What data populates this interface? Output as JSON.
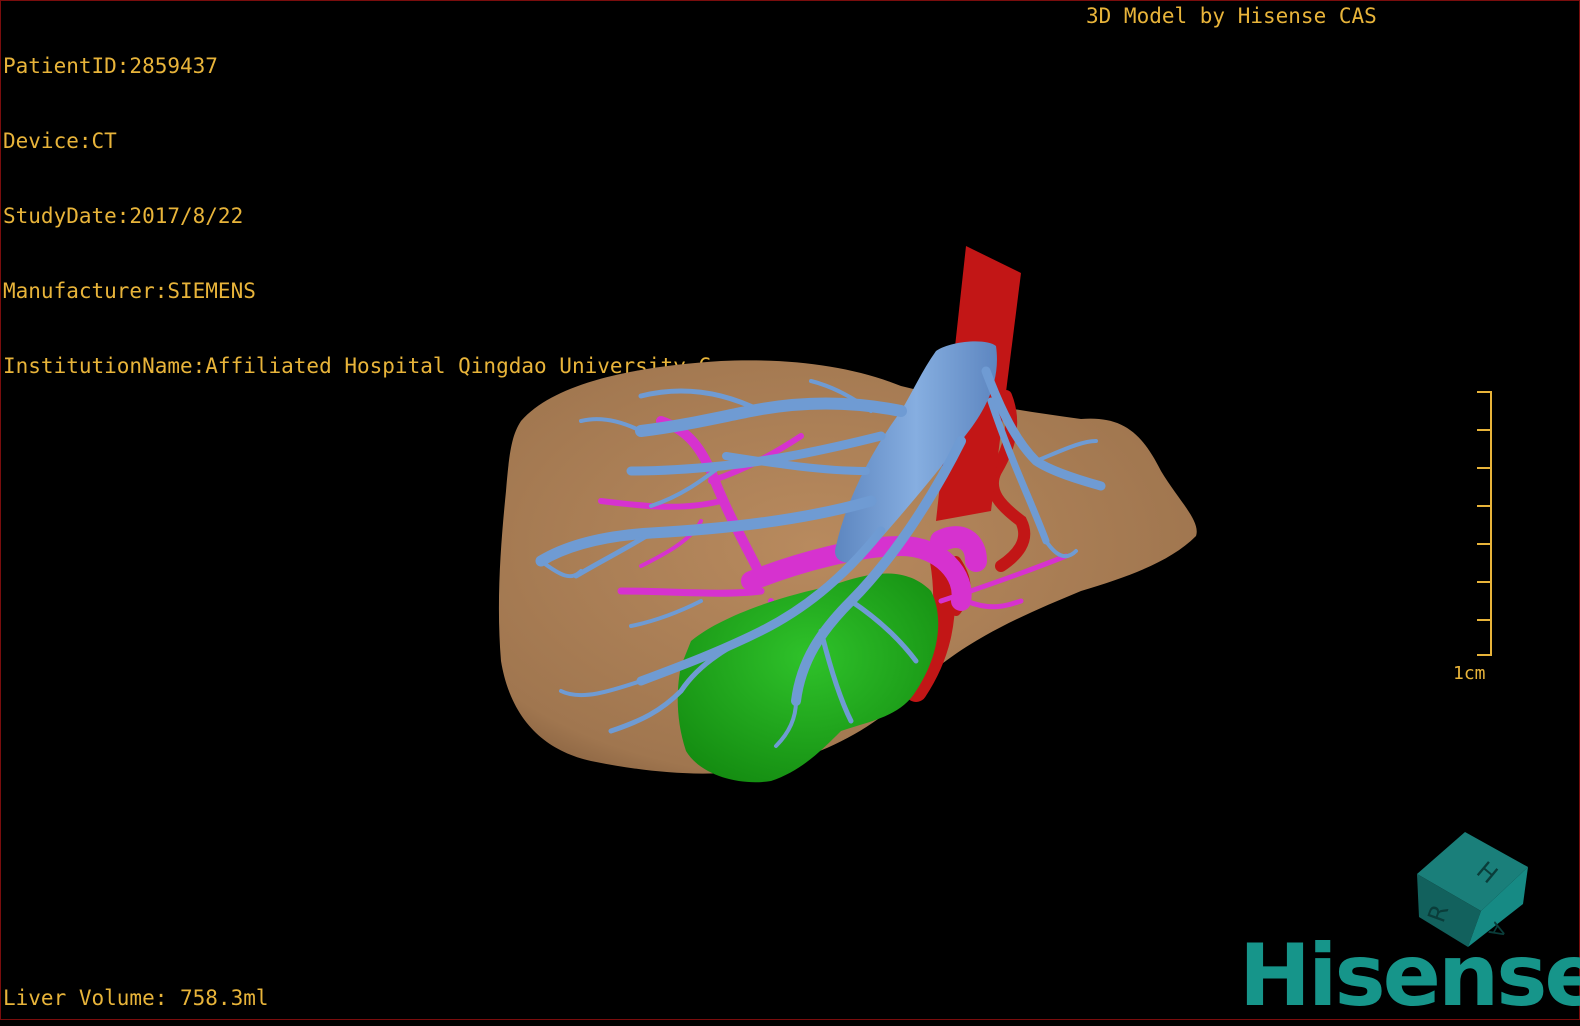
{
  "header": {
    "patient_id": "PatientID:2859437",
    "device": "Device:CT",
    "study_date": "StudyDate:2017/8/22",
    "manufacturer": "Manufacturer:SIEMENS",
    "institution": "InstitutionName:Affiliated Hospital Qingdao University-C"
  },
  "credit": "3D Model by Hisense CAS",
  "footer": {
    "liver_volume": "Liver Volume: 758.3ml"
  },
  "scale_bar": {
    "label": "1cm"
  },
  "orientation_cube": {
    "faces": [
      "H",
      "R",
      "A"
    ]
  },
  "logo": "Hisense",
  "colors": {
    "overlay_text": "#e8b43a",
    "liver": "#a77b53",
    "hepatic_vein": "#6f9bd3",
    "portal_vein": "#d632cf",
    "artery": "#c21616",
    "tumor": "#1fa61a",
    "brand": "#16958a"
  }
}
